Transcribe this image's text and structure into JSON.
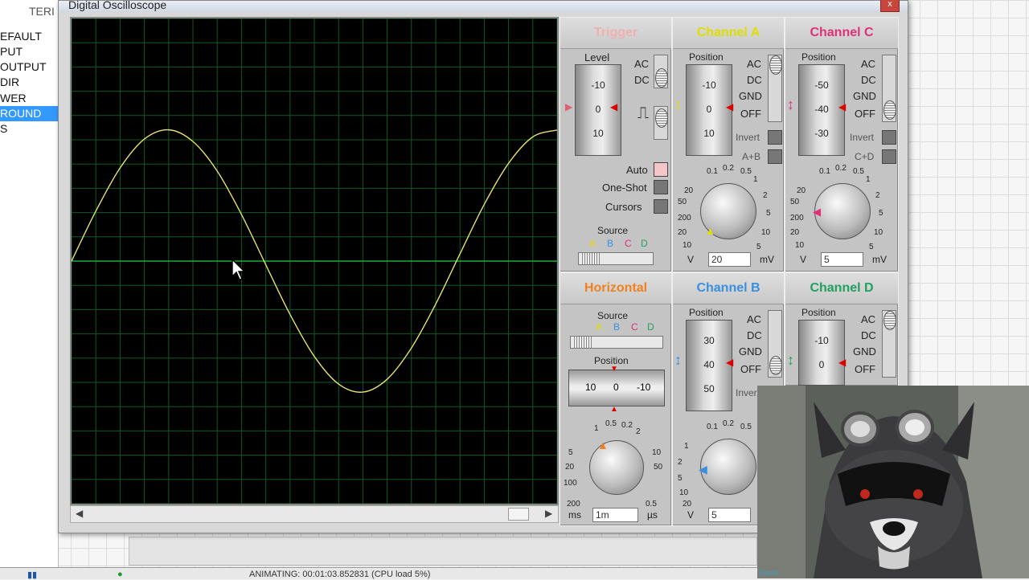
{
  "left_panel": {
    "tab_label": "TERI",
    "items": [
      "EFAULT",
      "PUT",
      "OUTPUT",
      "DIR",
      "WER",
      "ROUND",
      "S"
    ],
    "selected_index": 5
  },
  "window": {
    "title": "Digital Oscilloscope",
    "close_label": "x"
  },
  "trigger": {
    "title": "Trigger",
    "level_label": "Level",
    "level_scale": [
      "-10",
      "0",
      "10"
    ],
    "coupling": [
      "AC",
      "DC"
    ],
    "auto_label": "Auto",
    "oneshot_label": "One-Shot",
    "cursors_label": "Cursors",
    "source_label": "Source",
    "source_channels": [
      "A",
      "B",
      "C",
      "D"
    ]
  },
  "horizontal": {
    "title": "Horizontal",
    "source_label": "Source",
    "source_channels": [
      "A",
      "B",
      "C",
      "D"
    ],
    "position_label": "Position",
    "position_scale": [
      "10",
      "0",
      "-10"
    ],
    "timebase_value": "1m",
    "unit_ms": "ms",
    "unit_us": "µs",
    "dial_scale": [
      "0.5",
      "0.2",
      "1",
      "2",
      "5",
      "10",
      "20",
      "50",
      "100",
      "200",
      "0.5"
    ]
  },
  "channel_a": {
    "title": "Channel A",
    "position_label": "Position",
    "position_scale": [
      "-10",
      "0",
      "10"
    ],
    "coupling": [
      "AC",
      "DC",
      "GND",
      "OFF"
    ],
    "invert_label": "Invert",
    "combine_label": "A+B",
    "volts_value": "20",
    "unit_v": "V",
    "unit_mv": "mV",
    "dial_scale": [
      "0.2",
      "0.1",
      "0.5",
      "1",
      "2",
      "5",
      "10",
      "20",
      "50",
      "200",
      "20",
      "10",
      "5"
    ]
  },
  "channel_b": {
    "title": "Channel B",
    "position_label": "Position",
    "position_scale": [
      "30",
      "40",
      "50"
    ],
    "coupling": [
      "AC",
      "DC",
      "GND",
      "OFF"
    ],
    "invert_label": "Inver",
    "volts_value": "5",
    "unit_v": "V",
    "dial_scale": [
      "0.2",
      "0.1",
      "0.5",
      "1",
      "2",
      "5",
      "10",
      "20"
    ]
  },
  "channel_c": {
    "title": "Channel C",
    "position_label": "Position",
    "position_scale": [
      "-50",
      "-40",
      "-30"
    ],
    "coupling": [
      "AC",
      "DC",
      "GND",
      "OFF"
    ],
    "invert_label": "Invert",
    "combine_label": "C+D",
    "volts_value": "5",
    "unit_v": "V",
    "unit_mv": "mV",
    "dial_scale": [
      "0.2",
      "0.1",
      "0.5",
      "1",
      "2",
      "5",
      "10",
      "20",
      "50",
      "200",
      "20",
      "10",
      "5"
    ]
  },
  "channel_d": {
    "title": "Channel D",
    "position_label": "Position",
    "position_scale": [
      "-10",
      "0"
    ],
    "coupling": [
      "AC",
      "DC",
      "GND",
      "OFF"
    ]
  },
  "taskbar": {
    "status_text": "ANIMATING: 00:01:03.852831 (CPU load 5%)"
  },
  "colors": {
    "trace": "#e8e070",
    "grid": "#0e5a22",
    "trigger_title": "#f0b0b0",
    "horizontal_title": "#f08020",
    "channel_a": "#dede00",
    "channel_b": "#3a8fe0",
    "channel_c": "#e0307a",
    "channel_d": "#20a060"
  },
  "chart_data": {
    "type": "line",
    "title": "",
    "xlabel": "",
    "ylabel": "",
    "grid": true,
    "x": [
      0,
      1,
      2,
      3,
      4,
      5,
      6,
      7,
      8,
      9,
      10,
      11,
      12,
      13,
      14,
      15,
      16,
      17,
      18,
      19,
      20
    ],
    "series": [
      {
        "values": [
          0.0,
          2.06,
          3.84,
          5.03,
          5.41,
          4.93,
          3.71,
          1.92,
          -0.15,
          -2.2,
          -3.93,
          -5.07,
          -5.4,
          -4.87,
          -3.58,
          -1.77,
          0.3,
          2.34,
          4.03,
          5.12,
          5.4
        ]
      }
    ],
    "xlim": [
      0,
      20
    ],
    "ylim": [
      -10,
      10
    ]
  }
}
